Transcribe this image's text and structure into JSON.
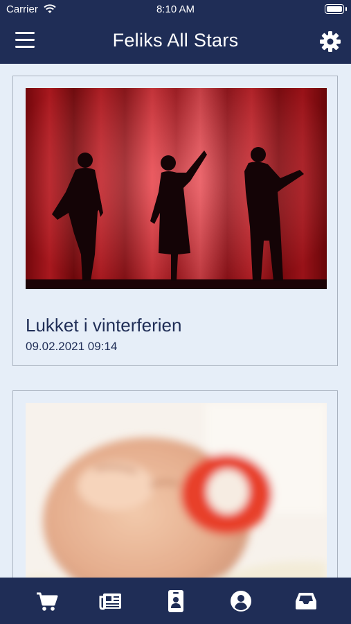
{
  "status_bar": {
    "carrier": "Carrier",
    "time": "8:10 AM"
  },
  "header": {
    "title": "Feliks All Stars",
    "menu_icon": "hamburger-menu-icon",
    "settings_icon": "gear-icon"
  },
  "posts": [
    {
      "title": "Lukket i vinterferien",
      "date": "09.02.2021 09:14",
      "image": "theater-curtain-silhouettes"
    },
    {
      "title": "",
      "date": "",
      "image": "sleeping-baby-pacifier"
    }
  ],
  "tabs": [
    {
      "icon": "shopping-cart-icon"
    },
    {
      "icon": "newspaper-icon"
    },
    {
      "icon": "contact-card-icon"
    },
    {
      "icon": "user-circle-icon"
    },
    {
      "icon": "inbox-icon"
    }
  ],
  "colors": {
    "navy": "#1f2d56",
    "background": "#e6eef8",
    "curtain_red": "#d01820",
    "pacifier_red": "#e8412b"
  }
}
